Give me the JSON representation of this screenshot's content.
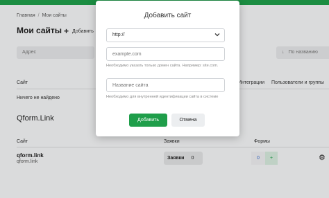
{
  "page": {
    "breadcrumb": [
      "Главная",
      "Мои сайты"
    ],
    "breadcrumb_sep": "/",
    "title": "Мои сайты",
    "add_site_label": "Добавить",
    "search_placeholder": "Адрес",
    "sort_label": "По названию",
    "columns": {
      "site": "Сайт",
      "integrations": "Интеграции",
      "users": "Пользователи и группы"
    },
    "not_found": "Ничего не найдено",
    "section_title": "Qform.Link",
    "table_headers": {
      "site": "Сайт",
      "orders": "Заявки",
      "forms": "Формы"
    },
    "row": {
      "name": "qform.link",
      "sub": "qform.link",
      "orders_label": "Заявки",
      "orders_count": "0",
      "forms_count": "0",
      "forms_add": "+"
    }
  },
  "modal": {
    "title": "Добавить сайт",
    "protocol_selected": "http://",
    "domain_placeholder": "example.com",
    "domain_hint": "Необходимо указать только домен сайта. Например: site.com.",
    "name_placeholder": "Название сайта",
    "name_hint": "Необходимо для внутренней идентификации сайта в системе",
    "submit_label": "Добавить",
    "cancel_label": "Отмена"
  },
  "colors": {
    "brand": "#1f9e4a"
  }
}
